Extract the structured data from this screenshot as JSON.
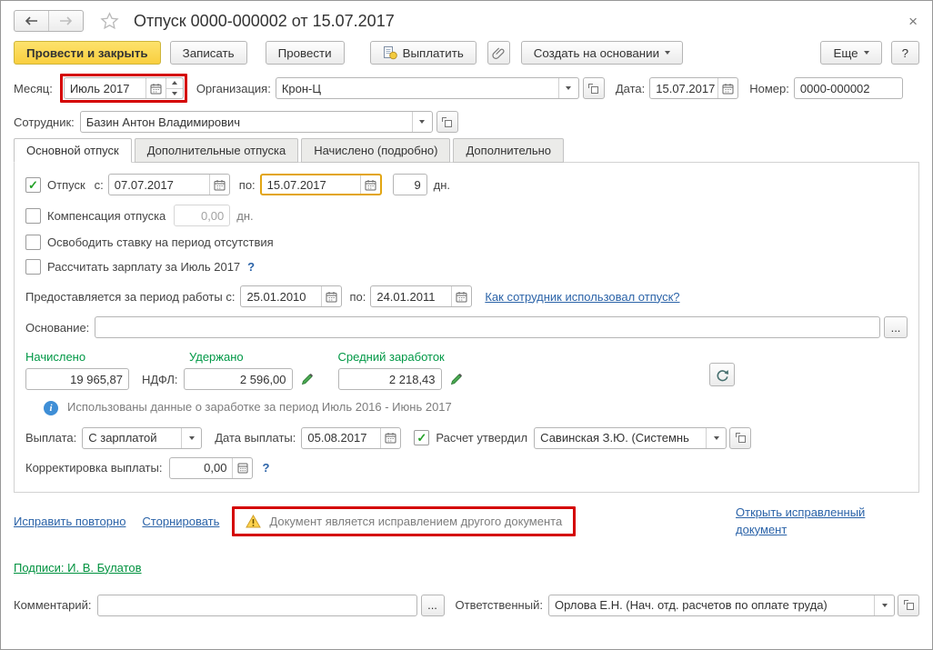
{
  "icons": {
    "check": "✓",
    "close": "×",
    "info_glyph": "i",
    "ellipsis": "...",
    "question": "?"
  },
  "header": {
    "title": "Отпуск 0000-000002 от 15.07.2017"
  },
  "toolbar": {
    "post_and_close": "Провести и закрыть",
    "write": "Записать",
    "post": "Провести",
    "pay": "Выплатить",
    "create_based_on": "Создать на основании",
    "more": "Еще",
    "help": "?"
  },
  "doc": {
    "month_label": "Месяц:",
    "month": "Июль 2017",
    "org_label": "Организация:",
    "org": "Крон-Ц",
    "date_label": "Дата:",
    "date": "15.07.2017",
    "number_label": "Номер:",
    "number": "0000-000002",
    "employee_label": "Сотрудник:",
    "employee": "Базин Антон Владимирович"
  },
  "tabs": [
    "Основной отпуск",
    "Дополнительные отпуска",
    "Начислено (подробно)",
    "Дополнительно"
  ],
  "vacation": {
    "label": "Отпуск",
    "from_label": "с:",
    "from": "07.07.2017",
    "to_label": "по:",
    "to": "15.07.2017",
    "days": "9",
    "days_unit": "дн."
  },
  "compensation": {
    "label": "Компенсация отпуска",
    "value": "0,00",
    "unit": "дн."
  },
  "options": {
    "release_rate": "Освободить ставку на период отсутствия",
    "calc_salary": "Рассчитать зарплату за Июль 2017"
  },
  "work_period": {
    "label": "Предоставляется за период работы с:",
    "from": "25.01.2010",
    "to_label": "по:",
    "to": "24.01.2011",
    "usage_link": "Как сотрудник использовал отпуск?"
  },
  "reason": {
    "label": "Основание:"
  },
  "totals": {
    "accrued_label": "Начислено",
    "accrued": "19 965,87",
    "withheld_label": "Удержано",
    "ndfl_label": "НДФЛ:",
    "ndfl": "2 596,00",
    "avg_label": "Средний заработок",
    "avg": "2 218,43",
    "info": "Использованы данные о заработке за период Июль 2016 - Июнь 2017"
  },
  "payment": {
    "label": "Выплата:",
    "method": "С зарплатой",
    "date_label": "Дата выплаты:",
    "date": "05.08.2017",
    "approved_label": "Расчет утвердил",
    "approver": "Савинская З.Ю. (Системнь",
    "adjust_label": "Корректировка выплаты:",
    "adjust": "0,00"
  },
  "footer": {
    "fix_again": "Исправить повторно",
    "reverse": "Сторнировать",
    "warning": "Документ является исправлением другого документа",
    "open_corrected": "Открыть исправленный документ",
    "signatures": "Подписи: И. В. Булатов",
    "comment_label": "Комментарий:",
    "responsible_label": "Ответственный:",
    "responsible": "Орлова Е.Н. (Нач. отд. расчетов по оплате труда)"
  },
  "colors": {
    "primary_button": "#f9cf3f",
    "annotation": "#d40000",
    "focus": "#e2a512",
    "green_label": "#009846",
    "link": "#2b63a8",
    "green_link": "#00923f"
  }
}
